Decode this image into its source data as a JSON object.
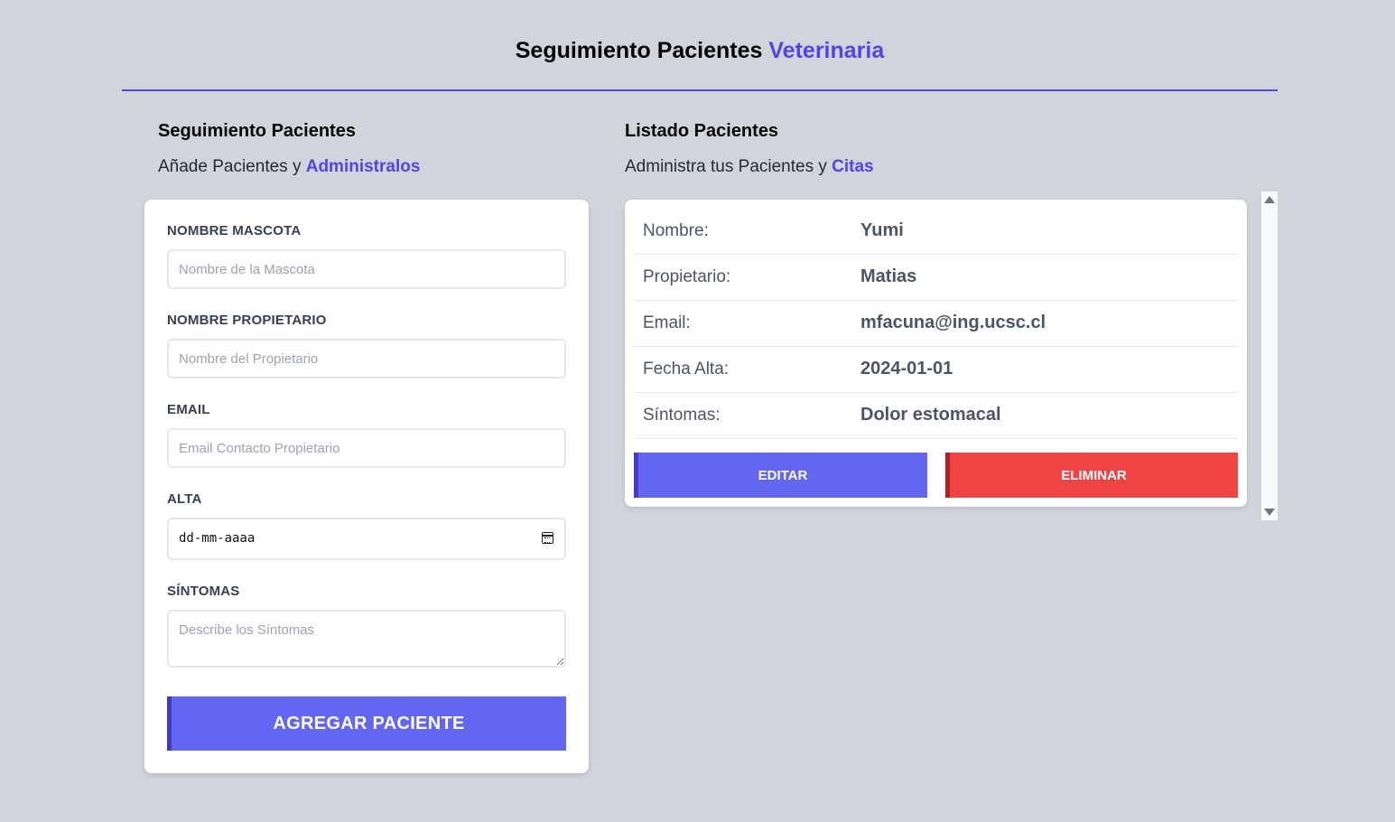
{
  "header": {
    "title": "Seguimiento Pacientes",
    "title_accent": "Veterinaria"
  },
  "form_section": {
    "title": "Seguimiento Pacientes",
    "subtitle": "Añade Pacientes y",
    "subtitle_accent": "Administralos",
    "fields": {
      "pet_name": {
        "label": "NOMBRE MASCOTA",
        "placeholder": "Nombre de la Mascota",
        "value": ""
      },
      "owner_name": {
        "label": "NOMBRE PROPIETARIO",
        "placeholder": "Nombre del Propietario",
        "value": ""
      },
      "email": {
        "label": "EMAIL",
        "placeholder": "Email Contacto Propietario",
        "value": ""
      },
      "discharge": {
        "label": "ALTA",
        "placeholder": "dd-mm-aaaa",
        "value": ""
      },
      "symptoms": {
        "label": "SÍNTOMAS",
        "placeholder": "Describe los Síntomas",
        "value": ""
      }
    },
    "submit_label": "AGREGAR PACIENTE"
  },
  "list_section": {
    "title": "Listado Pacientes",
    "subtitle": "Administra tus Pacientes y",
    "subtitle_accent": "Citas",
    "patients": [
      {
        "fields": [
          {
            "label": "Nombre:",
            "value": "Yumi"
          },
          {
            "label": "Propietario:",
            "value": "Matias"
          },
          {
            "label": "Email:",
            "value": "mfacuna@ing.ucsc.cl"
          },
          {
            "label": "Fecha Alta:",
            "value": "2024-01-01"
          },
          {
            "label": "Síntomas:",
            "value": "Dolor estomacal"
          }
        ],
        "edit_label": "EDITAR",
        "delete_label": "ELIMINAR"
      }
    ]
  },
  "colors": {
    "background": "#d1d5db",
    "accent": "#4f46e5",
    "primary_button": "#6366f1",
    "danger_button": "#ef4444"
  }
}
